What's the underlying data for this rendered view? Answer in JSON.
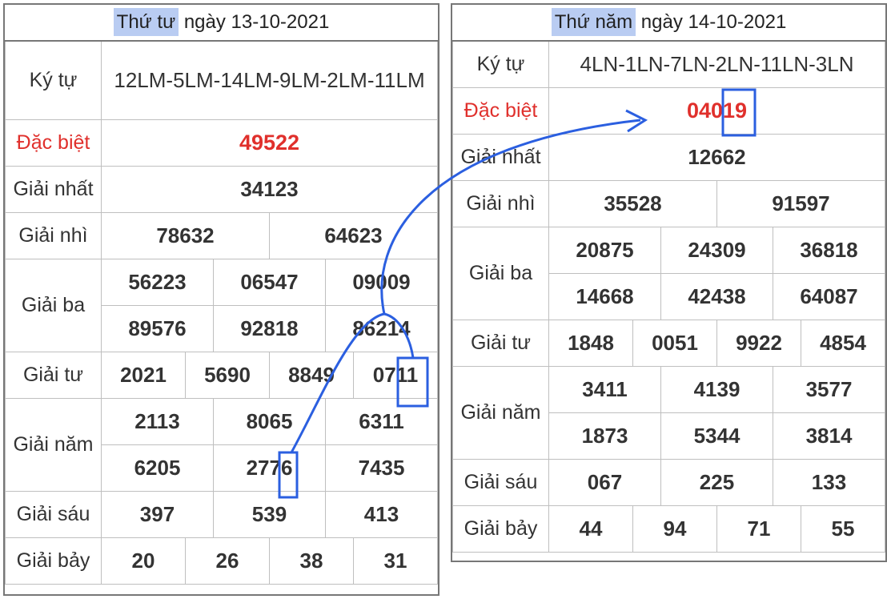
{
  "left": {
    "header": {
      "day": "Thứ tư",
      "rest": " ngày 13-10-2021"
    },
    "rows": {
      "ky_tu": {
        "label": "Ký tự",
        "value": "12LM-5LM-14LM-9LM-2LM-11LM"
      },
      "dac_biet": {
        "label": "Đặc biệt",
        "values": [
          "49522"
        ]
      },
      "giai_nhat": {
        "label": "Giải nhất",
        "values": [
          "34123"
        ]
      },
      "giai_nhi": {
        "label": "Giải nhì",
        "values": [
          "78632",
          "64623"
        ]
      },
      "giai_ba": {
        "label": "Giải ba",
        "values": [
          "56223",
          "06547",
          "09009",
          "89576",
          "92818",
          "86214"
        ]
      },
      "giai_tu": {
        "label": "Giải tư",
        "values": [
          "2021",
          "5690",
          "8849",
          "0711"
        ]
      },
      "giai_nam": {
        "label": "Giải năm",
        "values": [
          "2113",
          "8065",
          "6311",
          "6205",
          "2776",
          "7435"
        ]
      },
      "giai_sau": {
        "label": "Giải sáu",
        "values": [
          "397",
          "539",
          "413"
        ]
      },
      "giai_bay": {
        "label": "Giải bảy",
        "values": [
          "20",
          "26",
          "38",
          "31"
        ]
      }
    }
  },
  "right": {
    "header": {
      "day": "Thứ năm",
      "rest": " ngày 14-10-2021"
    },
    "rows": {
      "ky_tu": {
        "label": "Ký tự",
        "value": "4LN-1LN-7LN-2LN-11LN-3LN"
      },
      "dac_biet": {
        "label": "Đặc biệt",
        "values": [
          "04019"
        ]
      },
      "giai_nhat": {
        "label": "Giải nhất",
        "values": [
          "12662"
        ]
      },
      "giai_nhi": {
        "label": "Giải nhì",
        "values": [
          "35528",
          "91597"
        ]
      },
      "giai_ba": {
        "label": "Giải ba",
        "values": [
          "20875",
          "24309",
          "36818",
          "14668",
          "42438",
          "64087"
        ]
      },
      "giai_tu": {
        "label": "Giải tư",
        "values": [
          "1848",
          "0051",
          "9922",
          "4854"
        ]
      },
      "giai_nam": {
        "label": "Giải năm",
        "values": [
          "3411",
          "4139",
          "3577",
          "1873",
          "5344",
          "3814"
        ]
      },
      "giai_sau": {
        "label": "Giải sáu",
        "values": [
          "067",
          "225",
          "133"
        ]
      },
      "giai_bay": {
        "label": "Giải bảy",
        "values": [
          "44",
          "94",
          "71",
          "55"
        ]
      }
    }
  },
  "colors": {
    "special": "#e0302c",
    "header_highlight": "#b9ccf2",
    "annotation": "#2b5fe0"
  }
}
